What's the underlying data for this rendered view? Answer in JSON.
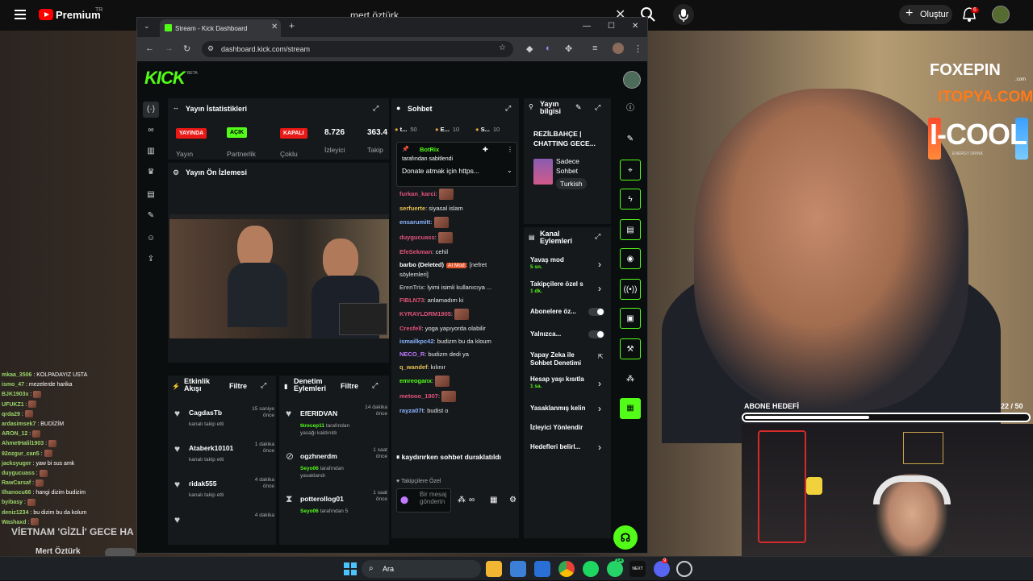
{
  "youtube": {
    "brand": "Premium",
    "region": "TR",
    "search_query": "mert öztürk",
    "create_label": "Oluştur",
    "notification_count": "6"
  },
  "overlay": {
    "sponsors": [
      "FOXEPIN",
      ".com",
      "ITOPYA.COM",
      "I-COOL",
      "ENERGY DRINK"
    ],
    "goal_label": "ABONE HEDEFİ",
    "goal_count": "22 / 50",
    "goal_progress": 0.44,
    "stream_title": "VİETNAM 'GİZLİ' GECE HA",
    "channel_name": "Mert Öztürk",
    "chat": [
      {
        "user": "mkaa_3506",
        "msg": "KOLPADAYIZ USTA"
      },
      {
        "user": "ismo_47",
        "msg": "mezelerde harika"
      },
      {
        "user": "BJK1903x",
        "msg": ""
      },
      {
        "user": "UFUKZ1",
        "msg": ""
      },
      {
        "user": "qrda29",
        "msg": ""
      },
      {
        "user": "ardasimsek7",
        "msg": "BUDİZİM"
      },
      {
        "user": "ARON_12",
        "msg": ""
      },
      {
        "user": "AhmetHalil1903",
        "msg": ""
      },
      {
        "user": "92ozgur_can5",
        "msg": ""
      },
      {
        "user": "jacksyuger",
        "msg": "yaw bi sus amk"
      },
      {
        "user": "duygucuass",
        "msg": ""
      },
      {
        "user": "RawCarsaf",
        "msg": ""
      },
      {
        "user": "Ilhanocu66",
        "msg": "hangi dizim budizim"
      },
      {
        "user": "byibasy",
        "msg": ""
      },
      {
        "user": "deniz1234",
        "msg": "bu dizim bu da kolum"
      },
      {
        "user": "Washaxd",
        "msg": ""
      }
    ]
  },
  "browser": {
    "tab_title": "Stream - Kick Dashboard",
    "url": "dashboard.kick.com/stream"
  },
  "kick": {
    "logo": "KICK",
    "beta": "BETA",
    "stats": {
      "title": "Yayın İstatistikleri",
      "items": [
        {
          "badge": "YAYINDA",
          "label": "Yayın"
        },
        {
          "badge": "AÇIK",
          "label": "Partnerlik"
        },
        {
          "badge": "KAPALI",
          "label": "Çoklu"
        },
        {
          "badge": "8.726",
          "label": "İzleyici"
        },
        {
          "badge": "363.4",
          "label": "Takip"
        }
      ]
    },
    "preview": {
      "title": "Yayın Ön İzlemesi"
    },
    "activity": {
      "title_line1": "Etkinlik",
      "title_line2": "Akışı",
      "filter": "Filtre",
      "items": [
        {
          "name": "CagdasTb",
          "sub": "kanalı takip etti",
          "time1": "15 saniye",
          "time2": "önce"
        },
        {
          "name": "Ataberk10101",
          "sub": "kanalı takip etti",
          "time1": "1 dakika",
          "time2": "önce"
        },
        {
          "name": "ridak555",
          "sub": "kanalı takip etti",
          "time1": "4 dakika",
          "time2": "önce"
        },
        {
          "name": "",
          "sub": "",
          "time1": "4 dakika",
          "time2": ""
        }
      ]
    },
    "moderation": {
      "title_line1": "Denetim",
      "title_line2": "Eylemleri",
      "filter": "Filtre",
      "items": [
        {
          "name": "EfERIDVAN",
          "mod": "tkrecep11",
          "sub": "tarafından yasağı kaldırıldı",
          "time1": "14 dakika",
          "time2": "önce"
        },
        {
          "name": "ogzhnerdm",
          "mod": "Seyo06",
          "sub": "tarafından yasaklandı",
          "time1": "1 saat",
          "time2": "önce"
        },
        {
          "name": "potterollog01",
          "mod": "Seyo06",
          "sub": "tarafından 5",
          "time1": "1 saat",
          "time2": "önce"
        }
      ]
    },
    "chat": {
      "title": "Sohbet",
      "tabs": [
        {
          "label": "t...",
          "count": "50"
        },
        {
          "label": "E...",
          "count": "10"
        },
        {
          "label": "S...",
          "count": "10"
        }
      ],
      "pinned_by": "BotRix",
      "pinned_sub": "tarafından sabitlendi",
      "pinned_msg": "Donate atmak için https...",
      "lines": [
        {
          "user": "furkan_karci",
          "color": "#e0547a",
          "msg": ""
        },
        {
          "user": "serfuerte",
          "color": "#e6c050",
          "msg": "siyasal islam"
        },
        {
          "user": "ensarumitt",
          "color": "#8ab4ff",
          "msg": ""
        },
        {
          "user": "duygucuass",
          "color": "#e0547a",
          "msg": ""
        },
        {
          "user": "EfeSekman",
          "color": "#e0547a",
          "msg": "cehil"
        },
        {
          "user": "barbo (Deleted)",
          "color": "#ffffff",
          "msg": "[nefret söylemleri]",
          "tag": "AI Mod"
        },
        {
          "user": "ErenTrix",
          "color": "#aaaaaa",
          "msg": "İyimi isimli kullanıcıya ..."
        },
        {
          "user": "FIBLN73",
          "color": "#e0547a",
          "msg": "anlamadım ki"
        },
        {
          "user": "KYRAYLDRM1905",
          "color": "#e0547a",
          "msg": ""
        },
        {
          "user": "Cresfell",
          "color": "#e0547a",
          "msg": "yoga yapıyorda olabilir"
        },
        {
          "user": "ismailkpc42",
          "color": "#8ab4ff",
          "msg": "budizm bu da kloum"
        },
        {
          "user": "NECO_R",
          "color": "#c07aff",
          "msg": "budizm dedi ya"
        },
        {
          "user": "q_wandef",
          "color": "#e6c050",
          "msg": "kılınır"
        },
        {
          "user": "emreoganx",
          "color": "#53fc18",
          "msg": ""
        },
        {
          "user": "metooo_1907",
          "color": "#e0547a",
          "msg": ""
        },
        {
          "user": "rayza07t",
          "color": "#8ab4ff",
          "msg": "budist o"
        }
      ],
      "paused": "kaydırırken sohbet duraklatıldı",
      "followers_only": "Takipçilere Özel",
      "input_placeholder": "Bir mesaj gönderin"
    },
    "stream_info": {
      "title_line1": "Yayın",
      "title_line2": "bilgisi",
      "stream_title": "REZİLBAHÇE | CHATTING GECE...",
      "category_line1": "Sadece",
      "category_line2": "Sohbet",
      "language": "Turkish"
    },
    "channel_actions": {
      "title_line1": "Kanal",
      "title_line2": "Eylemleri",
      "items": [
        {
          "label": "Yavaş mod",
          "sub": "5 sn.",
          "control": "chevron"
        },
        {
          "label": "Takipçilere özel s",
          "sub": "1 dk.",
          "control": "chevron"
        },
        {
          "label": "Abonelere öz...",
          "sub": "",
          "control": "toggle"
        },
        {
          "label": "Yalnızca...",
          "sub": "",
          "control": "toggle"
        },
        {
          "label": "Yapay Zeka ile Sohbet Denetimi",
          "sub": "",
          "control": "external"
        },
        {
          "label": "Hesap yaşı kısıtla",
          "sub": "1 sa.",
          "control": "chevron"
        },
        {
          "label": "Yasaklanmış kelin",
          "sub": "",
          "control": "chevron"
        },
        {
          "label": "İzleyici Yönlendir",
          "sub": "",
          "control": "none"
        },
        {
          "label": "Hedefleri belirl...",
          "sub": "",
          "control": "chevron"
        }
      ]
    }
  },
  "taskbar": {
    "search_label": "Ara",
    "whatsapp_badge": "14",
    "discord_badge": "9"
  },
  "colors": {
    "kick_green": "#53fc18",
    "live_red": "#e91916",
    "panel": "#16191c",
    "youtube_red": "#ff0000"
  }
}
